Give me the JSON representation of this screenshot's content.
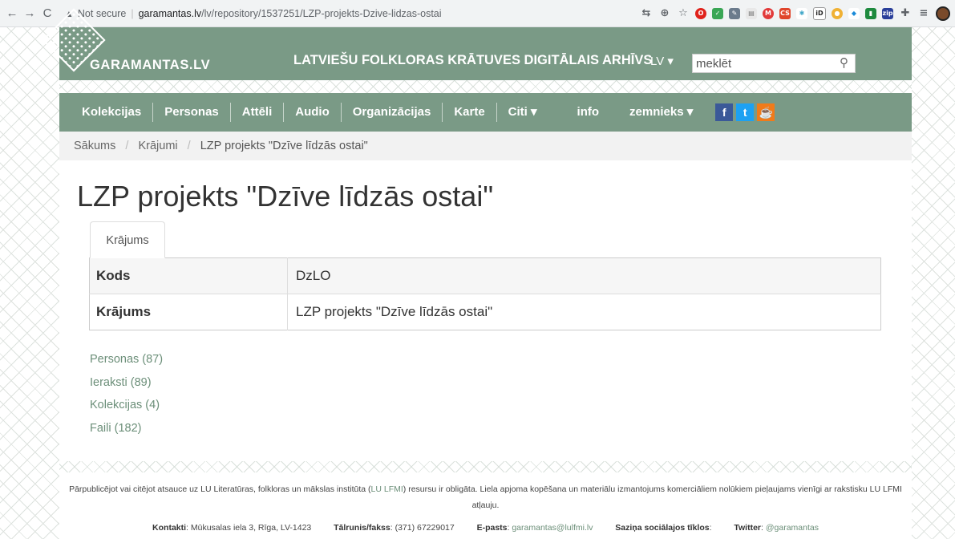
{
  "browser": {
    "back": "←",
    "forward": "→",
    "reload": "C",
    "security_label": "Not secure",
    "url_host": "garamantas.lv",
    "url_path": "/lv/repository/1537251/LZP-projekts-Dzive-lidzas-ostai",
    "icons": [
      "translate-icon",
      "zoom-icon",
      "star-icon",
      "opera-icon",
      "check-icon",
      "pen-icon",
      "doc-icon",
      "m-icon",
      "cs-icon",
      "react-icon",
      "id-icon",
      "circle-icon",
      "diamond-icon",
      "book-icon",
      "zip-icon",
      "puzzle-icon",
      "list-icon"
    ]
  },
  "header": {
    "logo_text": "GARAMANTAS.LV",
    "site_title": "LATVIEŠU FOLKLORAS KRĀTUVES DIGITĀLAIS ARHĪVS",
    "lang": "LV ▾",
    "search_placeholder": "meklēt"
  },
  "nav": {
    "items": [
      "Kolekcijas",
      "Personas",
      "Attēli",
      "Audio",
      "Organizācijas",
      "Karte",
      "Citi ▾",
      "info",
      "zemnieks ▾"
    ],
    "social": [
      "f",
      "t",
      "☕"
    ]
  },
  "breadcrumb": [
    "Sākums",
    "Krājumi",
    "LZP projekts \"Dzīve līdzās ostai\""
  ],
  "main": {
    "title": "LZP projekts \"Dzīve līdzās ostai\"",
    "tab": "Krājums",
    "rows": [
      {
        "key": "Kods",
        "value": "DzLO"
      },
      {
        "key": "Krājums",
        "value": "LZP projekts \"Dzīve līdzās ostai\""
      }
    ],
    "links": [
      "Personas (87)",
      "Ieraksti (89)",
      "Kolekcijas (4)",
      "Faili (182)"
    ]
  },
  "footer": {
    "notice_part1": "Pārpublicējot vai citējot atsauce uz LU Literatūras, folkloras un mākslas institūta (",
    "notice_link": "LU LFMI",
    "notice_part2": ") resursu ir obligāta. Liela apjoma kopēšana un materiālu izmantojums komerciāliem nolūkiem pieļaujams vienīgi ar rakstisku LU LFMI atļauju.",
    "contacts_label": "Kontakti",
    "contacts_value": ": Mūkusalas iela 3, Rīga, LV-1423",
    "phone_label": "Tālrunis/fakss",
    "phone_value": ": (371) 67229017",
    "email_label": "E-pasts",
    "email_value": "garamantas@lulfmi.lv",
    "social_label": "Saziņa sociālajos tīklos",
    "twitter_label": "Twitter",
    "twitter_value": "@garamantas"
  },
  "colors": {
    "brand_green": "#7a9a86",
    "link_green": "#6c8f79"
  }
}
